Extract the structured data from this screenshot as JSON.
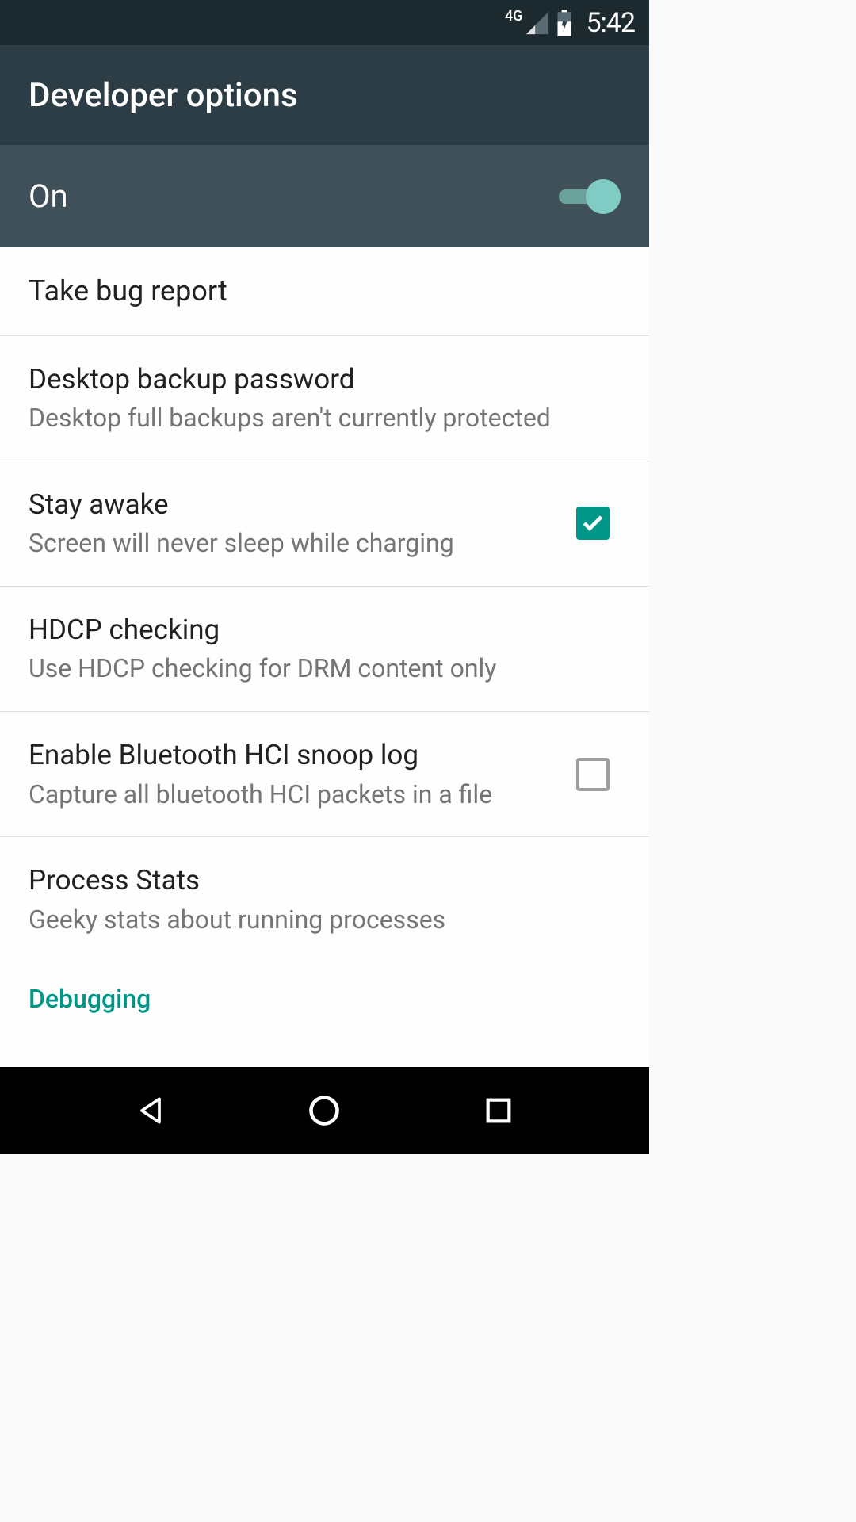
{
  "statusBar": {
    "networkLabel": "4G",
    "time": "5:42"
  },
  "appBar": {
    "title": "Developer options"
  },
  "masterToggle": {
    "label": "On",
    "on": true
  },
  "settings": [
    {
      "title": "Take bug report",
      "subtitle": null,
      "control": null
    },
    {
      "title": "Desktop backup password",
      "subtitle": "Desktop full backups aren't currently protected",
      "control": null
    },
    {
      "title": "Stay awake",
      "subtitle": "Screen will never sleep while charging",
      "control": "checkbox",
      "checked": true
    },
    {
      "title": "HDCP checking",
      "subtitle": "Use HDCP checking for DRM content only",
      "control": null
    },
    {
      "title": "Enable Bluetooth HCI snoop log",
      "subtitle": "Capture all bluetooth HCI packets in a file",
      "control": "checkbox",
      "checked": false
    },
    {
      "title": "Process Stats",
      "subtitle": "Geeky stats about running processes",
      "control": null
    }
  ],
  "sectionHeader": "Debugging"
}
